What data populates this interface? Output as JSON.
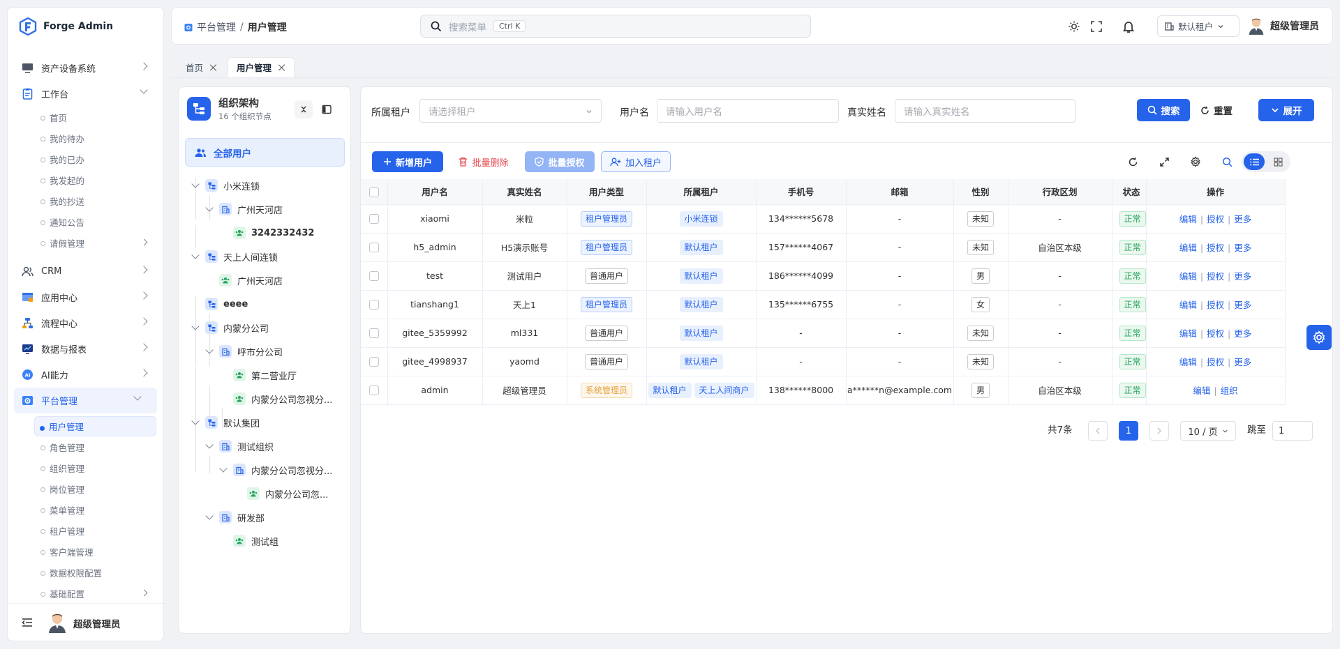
{
  "app": {
    "name": "Forge Admin"
  },
  "sidebar": {
    "items": [
      {
        "label": "资产设备系统",
        "icon": "monitor-icon"
      },
      {
        "label": "工作台",
        "icon": "clipboard-icon"
      },
      {
        "label": "CRM",
        "icon": "users-icon"
      },
      {
        "label": "应用中心",
        "icon": "app-window-icon"
      },
      {
        "label": "流程中心",
        "icon": "flow-icon"
      },
      {
        "label": "数据与报表",
        "icon": "chart-screen-icon"
      },
      {
        "label": "AI能力",
        "icon": "ai-icon"
      },
      {
        "label": "平台管理",
        "icon": "platform-gear-icon"
      }
    ],
    "workbench_sub": [
      "首页",
      "我的待办",
      "我的已办",
      "我发起的",
      "我的抄送",
      "通知公告",
      "请假管理"
    ],
    "platform_sub": [
      "用户管理",
      "角色管理",
      "组织管理",
      "岗位管理",
      "菜单管理",
      "租户管理",
      "客户端管理",
      "数据权限配置",
      "基础配置"
    ],
    "footer_user": "超级管理员"
  },
  "header": {
    "breadcrumb": [
      "平台管理",
      "/",
      "用户管理"
    ],
    "search_placeholder": "搜索菜单",
    "search_shortcut": "Ctrl K",
    "tenant": "默认租户",
    "user": "超级管理员"
  },
  "tabs": [
    {
      "label": "首页"
    },
    {
      "label": "用户管理"
    }
  ],
  "org": {
    "title": "组织架构",
    "subtitle": "16 个组织节点",
    "all_users": "全部用户",
    "nodes": [
      "小米连锁",
      "广州天河店",
      "3242332432",
      "天上人间连锁",
      "广州天河店",
      "eeee",
      "内蒙分公司",
      "呼市分公司",
      "第二营业厅",
      "内蒙分公司忽视分...",
      "默认集团",
      "测试组织",
      "内蒙分公司忽视分...",
      "内蒙分公司忽...",
      "研发部",
      "测试组"
    ]
  },
  "filters": {
    "tenant_label": "所属租户",
    "tenant_placeholder": "请选择租户",
    "username_label": "用户名",
    "username_placeholder": "请输入用户名",
    "realname_label": "真实姓名",
    "realname_placeholder": "请输入真实姓名",
    "search": "搜索",
    "reset": "重置",
    "expand": "展开"
  },
  "toolbar": {
    "add": "新增用户",
    "batch_delete": "批量删除",
    "batch_auth": "批量授权",
    "join_tenant": "加入租户"
  },
  "table": {
    "columns": [
      "用户名",
      "真实姓名",
      "用户类型",
      "所属租户",
      "手机号",
      "邮箱",
      "性别",
      "行政区划",
      "状态",
      "操作"
    ],
    "rows": [
      {
        "username": "xiaomi",
        "realname": "米粒",
        "type": "租户管理员",
        "tenants": [
          "小米连锁"
        ],
        "phone": "134******5678",
        "email": "-",
        "gender": "未知",
        "region": "-",
        "status": "正常",
        "ops": [
          "编辑",
          "授权",
          "更多"
        ]
      },
      {
        "username": "h5_admin",
        "realname": "H5演示账号",
        "type": "租户管理员",
        "tenants": [
          "默认租户"
        ],
        "phone": "157******4067",
        "email": "-",
        "gender": "未知",
        "region": "自治区本级",
        "status": "正常",
        "ops": [
          "编辑",
          "授权",
          "更多"
        ]
      },
      {
        "username": "test",
        "realname": "测试用户",
        "type": "普通用户",
        "tenants": [
          "默认租户"
        ],
        "phone": "186******4099",
        "email": "-",
        "gender": "男",
        "region": "-",
        "status": "正常",
        "ops": [
          "编辑",
          "授权",
          "更多"
        ]
      },
      {
        "username": "tianshang1",
        "realname": "天上1",
        "type": "租户管理员",
        "tenants": [
          "默认租户"
        ],
        "phone": "135******6755",
        "email": "-",
        "gender": "女",
        "region": "-",
        "status": "正常",
        "ops": [
          "编辑",
          "授权",
          "更多"
        ]
      },
      {
        "username": "gitee_5359992",
        "realname": "ml331",
        "type": "普通用户",
        "tenants": [
          "默认租户"
        ],
        "phone": "-",
        "email": "-",
        "gender": "未知",
        "region": "-",
        "status": "正常",
        "ops": [
          "编辑",
          "授权",
          "更多"
        ]
      },
      {
        "username": "gitee_4998937",
        "realname": "yaomd",
        "type": "普通用户",
        "tenants": [
          "默认租户"
        ],
        "phone": "-",
        "email": "-",
        "gender": "未知",
        "region": "-",
        "status": "正常",
        "ops": [
          "编辑",
          "授权",
          "更多"
        ]
      },
      {
        "username": "admin",
        "realname": "超级管理员",
        "type": "系统管理员",
        "tenants": [
          "默认租户",
          "天上人间商户"
        ],
        "phone": "138******8000",
        "email": "a******n@example.com",
        "gender": "男",
        "region": "自治区本级",
        "status": "正常",
        "ops": [
          "编辑",
          "组织"
        ]
      }
    ]
  },
  "pagination": {
    "total": "共7条",
    "current": "1",
    "page_size": "10 / 页",
    "jump_label": "跳至",
    "jump_value": "1"
  },
  "colors": {
    "primary": "#2563eb",
    "success": "#22a55b",
    "warning": "#e6a23c",
    "danger": "#e5484d"
  }
}
